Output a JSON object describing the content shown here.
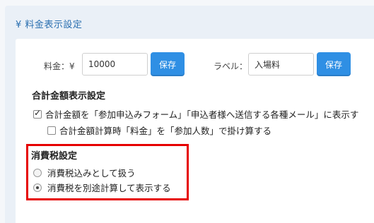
{
  "section": {
    "title": "¥ 料金表示設定"
  },
  "price": {
    "label": "料金：¥",
    "value": "10000",
    "save_label": "保存"
  },
  "label_field": {
    "label": "ラベル：",
    "value": "入場料",
    "save_label": "保存"
  },
  "total": {
    "heading": "合計金額表示設定",
    "show_total_label": "合計金額を「参加申込みフォーム」「申込者様へ送信する各種メール」に表示す",
    "show_total_checked": true,
    "multiply_label": "合計金額計算時「料金」を「参加人数」で掛け算する",
    "multiply_checked": false
  },
  "tax": {
    "heading": "消費税設定",
    "options": [
      {
        "label": "消費税込みとして扱う",
        "selected": false
      },
      {
        "label": "消費税を別途計算して表示する",
        "selected": true
      }
    ]
  },
  "colors": {
    "accent": "#2f8fe4",
    "title": "#2a6fb0",
    "highlight": "#e60000"
  }
}
